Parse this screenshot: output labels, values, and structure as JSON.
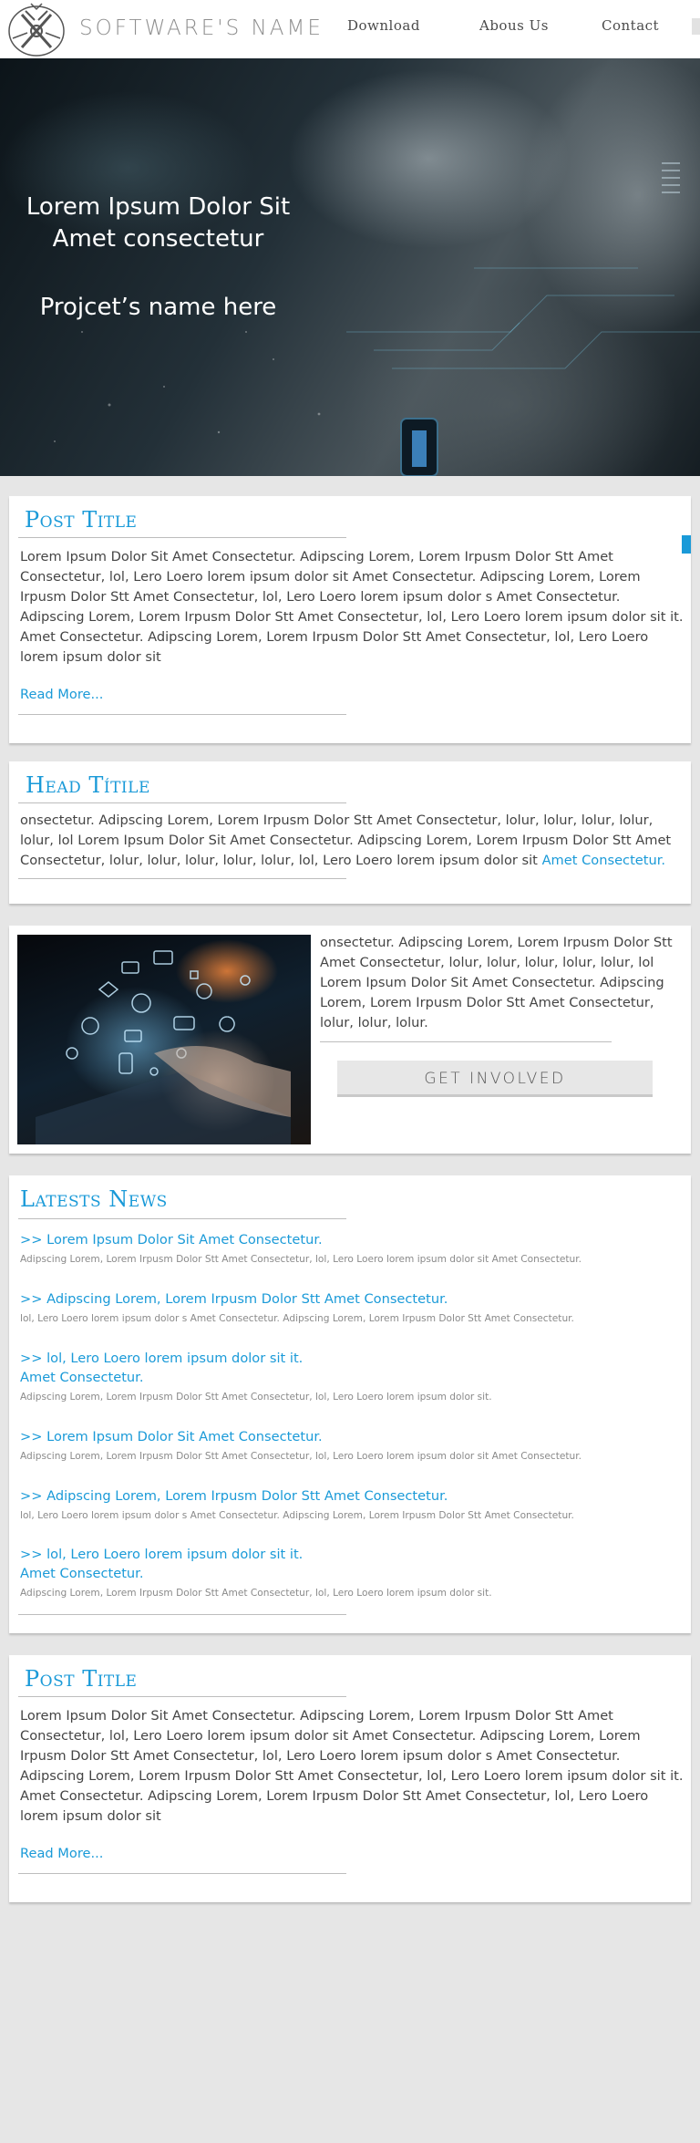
{
  "header": {
    "brand": "SOFTWARE'S NAME",
    "nav": {
      "download": "Download",
      "about": "Abous Us",
      "contact": "Contact"
    }
  },
  "hero": {
    "title_line1": "Lorem Ipsum Dolor Sit",
    "title_line2": "Amet consectetur",
    "subtitle": "Projcet’s name here"
  },
  "post1": {
    "title": "Post Title",
    "body": "Lorem Ipsum Dolor Sit Amet Consectetur. Adipscing Lorem, Lorem Irpusm Dolor Stt Amet Consectetur, lol, Lero Loero lorem ipsum dolor sit Amet Consectetur. Adipscing Lorem, Lorem Irpusm Dolor Stt Amet Consectetur, lol, Lero Loero lorem ipsum dolor s Amet Consectetur. Adipscing Lorem, Lorem Irpusm Dolor Stt Amet Consectetur, lol, Lero Loero lorem ipsum dolor sit it.",
    "body2": "Amet Consectetur. Adipscing Lorem, Lorem Irpusm Dolor Stt Amet Consectetur, lol, Lero Loero lorem ipsum dolor sit",
    "read_more": "Read More..."
  },
  "head": {
    "title": "Head Títile",
    "body": "onsectetur. Adipscing Lorem, Lorem Irpusm Dolor Stt Amet Consectetur, lolur, lolur, lolur, lolur, lolur, lol Lorem Ipsum Dolor Sit Amet Consectetur. Adipscing Lorem, Lorem Irpusm Dolor Stt Amet Consectetur, lolur, lolur, lolur, lolur, lolur, lol, Lero Loero lorem ipsum dolor sit ",
    "link": "Amet Consectetur."
  },
  "feature": {
    "body": "onsectetur. Adipscing Lorem, Lorem Irpusm Dolor Stt Amet Consectetur, lolur, lolur, lolur, lolur, lolur, lol Lorem Ipsum Dolor Sit Amet Consectetur. Adipscing Lorem, Lorem Irpusm Dolor Stt Amet Consectetur, lolur, lolur, lolur.",
    "button": "GET INVOLVED"
  },
  "news": {
    "title": "Latests News",
    "items": [
      {
        "headline": ">> Lorem Ipsum Dolor Sit Amet Consectetur.",
        "text": "Adipscing Lorem, Lorem Irpusm Dolor Stt Amet Consectetur, lol, Lero Loero lorem ipsum dolor sit Amet Consectetur."
      },
      {
        "headline": ">> Adipscing Lorem, Lorem Irpusm Dolor Stt Amet Consectetur.",
        "text": "lol, Lero Loero lorem ipsum dolor s Amet Consectetur. Adipscing Lorem, Lorem Irpusm Dolor Stt Amet Consectetur."
      },
      {
        "headline": ">> lol, Lero Loero lorem ipsum dolor sit it.",
        "headline2": "Amet Consectetur.",
        "text": "Adipscing Lorem, Lorem Irpusm Dolor Stt Amet Consectetur, lol, Lero Loero lorem ipsum dolor sit."
      },
      {
        "headline": ">> Lorem Ipsum Dolor Sit Amet Consectetur.",
        "text": "Adipscing Lorem, Lorem Irpusm Dolor Stt Amet Consectetur, lol, Lero Loero lorem ipsum dolor sit Amet Consectetur."
      },
      {
        "headline": ">> Adipscing Lorem, Lorem Irpusm Dolor Stt Amet Consectetur.",
        "text": "lol, Lero Loero lorem ipsum dolor s Amet Consectetur. Adipscing Lorem, Lorem Irpusm Dolor Stt Amet Consectetur."
      },
      {
        "headline": ">> lol, Lero Loero lorem ipsum dolor sit it.",
        "headline2": "Amet Consectetur.",
        "text": "Adipscing Lorem, Lorem Irpusm Dolor Stt Amet Consectetur, lol, Lero Loero lorem ipsum dolor sit."
      }
    ]
  },
  "post2": {
    "title": "Post Title",
    "body": "Lorem Ipsum Dolor Sit Amet Consectetur. Adipscing Lorem, Lorem Irpusm Dolor Stt Amet Consectetur, lol, Lero Loero lorem ipsum dolor sit Amet Consectetur. Adipscing Lorem, Lorem Irpusm Dolor Stt Amet Consectetur, lol, Lero Loero lorem ipsum dolor s Amet Consectetur. Adipscing Lorem, Lorem Irpusm Dolor Stt Amet Consectetur, lol, Lero Loero lorem ipsum dolor sit it.",
    "body2": "Amet Consectetur. Adipscing Lorem, Lorem Irpusm Dolor Stt Amet Consectetur, lol, Lero Loero lorem ipsum dolor sit",
    "read_more": "Read More..."
  },
  "colors": {
    "accent": "#1a9ad8",
    "background": "#e6e6e6",
    "card": "#ffffff",
    "text": "#444444"
  }
}
